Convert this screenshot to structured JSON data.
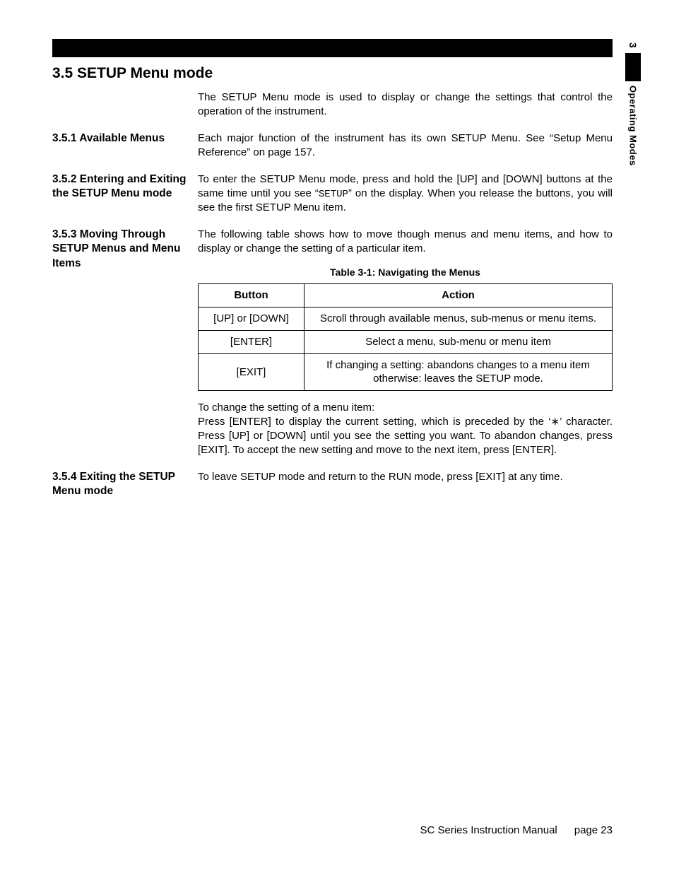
{
  "sideTab": {
    "chapter": "3",
    "label": "Operating Modes"
  },
  "sectionTitle": "3.5  SETUP Menu mode",
  "intro": "The SETUP Menu mode is used to display or change the settings that control the operation of the instrument.",
  "s351": {
    "heading": "3.5.1 Available Menus",
    "body": "Each major function of the instrument has its own SETUP Menu. See “Setup Menu Reference” on page 157."
  },
  "s352": {
    "heading": "3.5.2 Entering and Exiting the SETUP Menu mode",
    "body_a": "To enter the SETUP Menu mode, press and hold the [UP] and [DOWN] buttons at the same time until you see “",
    "body_mono": "SETUP",
    "body_b": "” on the display.  When you release the buttons, you will see the first SETUP Menu item."
  },
  "s353": {
    "heading": "3.5.3 Moving Through SETUP Menus and Menu Items",
    "lead": "The following table shows how to move though menus and menu items, and how to display or change the setting of a particular item.",
    "tableCaption": "Table 3-1: Navigating the Menus",
    "table": {
      "headers": [
        "Button",
        "Action"
      ],
      "rows": [
        {
          "button": "[UP] or [DOWN]",
          "action": "Scroll through available menus, sub-menus or menu items."
        },
        {
          "button": "[ENTER]",
          "action": "Select a menu, sub-menu or menu item"
        },
        {
          "button": "[EXIT]",
          "action": "If changing a setting: abandons changes to a menu item otherwise: leaves the SETUP mode."
        }
      ]
    },
    "after1": "To change the setting of a menu item:",
    "after2": "Press [ENTER] to display the current setting, which is preceded by the ‘∗’ character. Press [UP] or [DOWN] until you see the setting you want.  To abandon changes, press [EXIT].   To accept the new setting and move to the next item, press [ENTER]."
  },
  "s354": {
    "heading": "3.5.4 Exiting the SETUP Menu mode",
    "body": "To leave SETUP mode and return to the RUN mode, press [EXIT] at any time."
  },
  "footer": {
    "manual": "SC Series Instruction Manual",
    "page": "page 23"
  }
}
